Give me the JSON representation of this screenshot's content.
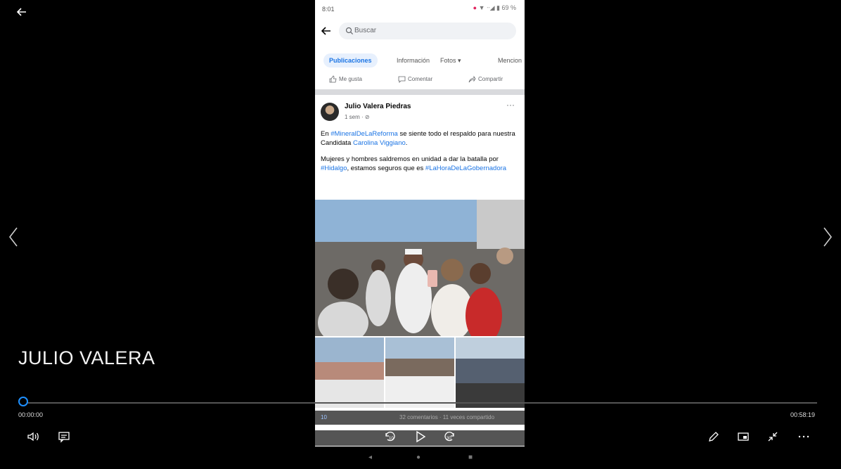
{
  "video": {
    "title": "JULIO VALERA",
    "elapsed": "00:00:00",
    "total": "00:58:19",
    "progress": 0
  },
  "phone": {
    "status_time": "8:01",
    "status_icons": "▼ ᐧᐧ◢ ▮ 69 %",
    "search_placeholder": "Buscar",
    "tabs": [
      "Publicaciones",
      "Información",
      "Fotos ▾",
      "Mencion"
    ],
    "actions": [
      "Me gusta",
      "Comentar",
      "Compartir"
    ],
    "post": {
      "author": "Julio Valera Piedras",
      "meta": "1 sem · ⊘",
      "more": "···",
      "p1_a": "En ",
      "p1_tag": "#MineralDeLaReforma",
      "p1_b": " se siente todo el respaldo para nuestra Candidata ",
      "p1_name": "Carolina Viggiano",
      "p1_c": ".",
      "p2_a": "Mujeres y hombres saldremos en unidad a dar la batalla por ",
      "p2_tag": "#Hidalgo",
      "p2_b": ", estamos seguros que es ",
      "p2_tag2": "#LaHoraDeLaGobernadora"
    },
    "reactions": "10",
    "reactions_right": "32 comentarios · 11 veces compartido"
  },
  "colors": {
    "accent": "#1e90ff",
    "fb_blue": "#1b74e4",
    "background": "#000000"
  },
  "icons": [
    "back-arrow-icon",
    "chevron-left-icon",
    "chevron-right-icon",
    "volume-icon",
    "captions-icon",
    "skip-back-10-icon",
    "play-icon",
    "skip-forward-30-icon",
    "pen-icon",
    "miniview-icon",
    "exit-fullscreen-icon",
    "more-icon"
  ]
}
